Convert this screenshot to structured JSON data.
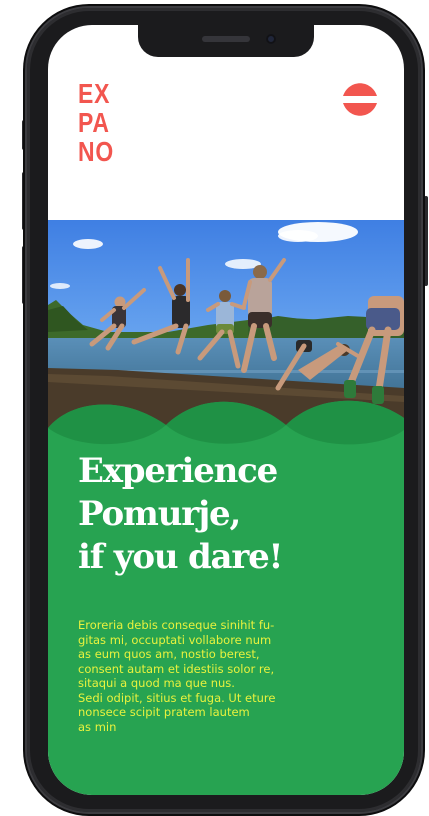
{
  "brand": {
    "logo_lines": [
      "EX",
      "PA",
      "NO"
    ]
  },
  "menu": {
    "icon": "menu-icon"
  },
  "hero": {
    "title_lines": [
      "Experience",
      "Pomurje,",
      "if you dare!"
    ],
    "body": "Eroreria debis conseque sinihit fu-\ngitas mi, occuptati vollabore num\nas eum quos am, nostio berest,\nconsent autam et idestiis solor re,\nsitaqui a quod ma que nus.\nSedi odipit, sitius et fuga. Ut eture\nnonsece scipit pratem lautem\nas min"
  },
  "colors": {
    "accent_red": "#f2564f",
    "panel_green": "#27a351",
    "body_text_yellow": "#e8f23e",
    "headline_white": "#ffffff"
  }
}
